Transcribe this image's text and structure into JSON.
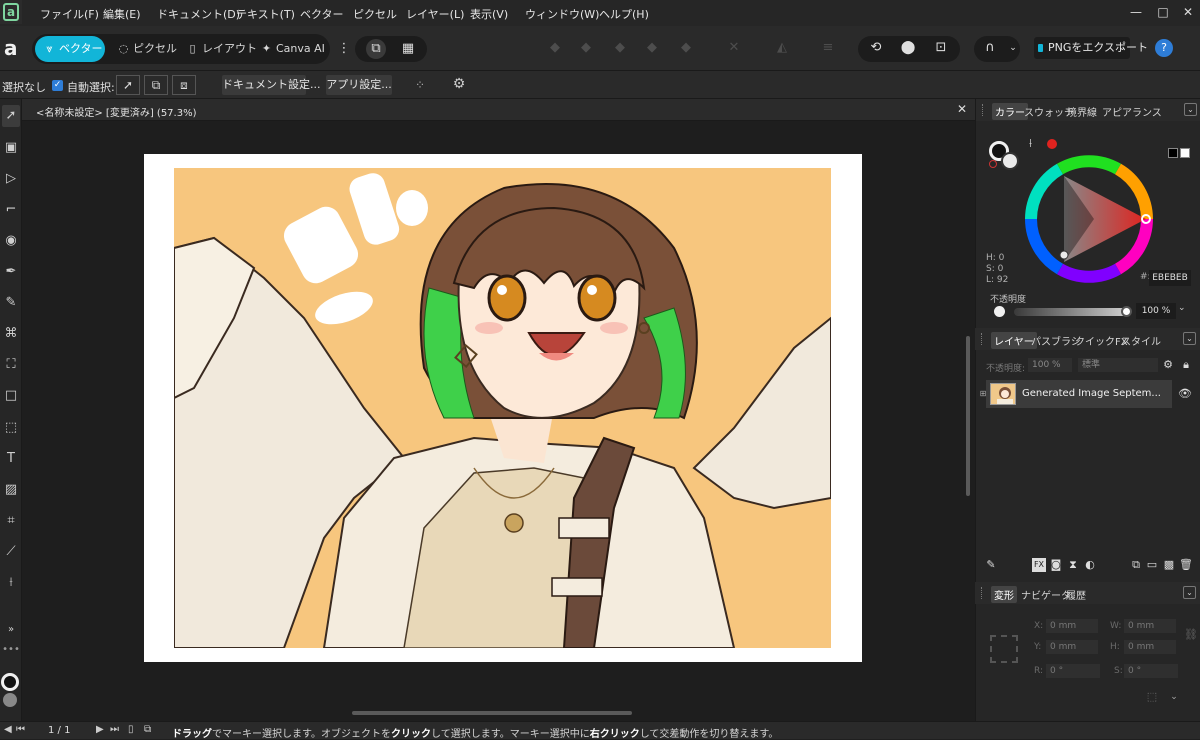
{
  "menubar": {
    "items": [
      "ファイル(F)",
      "編集(E)",
      "ドキュメント(D)",
      "テキスト(T)",
      "ベクター",
      "ピクセル",
      "レイヤー(L)",
      "表示(V)",
      "ウィンドウ(W)",
      "ヘルプ(H)"
    ],
    "window_controls": [
      "—",
      "□",
      "✕"
    ]
  },
  "toolbar": {
    "personas": [
      "ベクター",
      "ピクセル",
      "レイアウト",
      "Canva AI"
    ],
    "active_persona": "ベクター",
    "export_label": "PNGをエクスポート",
    "help_label": "?"
  },
  "contextbar": {
    "selection_text": "選択なし",
    "auto_select_label": "自動選択:",
    "document_settings": "ドキュメント設定...",
    "app_settings": "アプリ設定..."
  },
  "document": {
    "tab_title": "<名称未設定> [変更済み] (57.3%)"
  },
  "color_panel": {
    "tabs": [
      "カラー",
      "スウォッチ",
      "境界線",
      "アピアランス"
    ],
    "active_tab": "カラー",
    "h_label": "H: 0",
    "s_label": "S: 0",
    "l_label": "L: 92",
    "hex_prefix": "#:",
    "hex_value": "EBEBEB",
    "opacity_label": "不透明度",
    "opacity_value": "100 %",
    "accent_color": "#e0231f",
    "current_color": "#ebebeb"
  },
  "layers_panel": {
    "tabs": [
      "レイヤー",
      "パスブラシ",
      "クイックFX",
      "スタイル"
    ],
    "active_tab": "レイヤー",
    "opacity_label": "不透明度:",
    "opacity_value": "100 %",
    "blend_mode": "標準",
    "layers": [
      {
        "name": "Generated Image Septem...",
        "visible": true
      }
    ]
  },
  "transform_panel": {
    "tabs": [
      "変形",
      "ナビゲータ",
      "履歴"
    ],
    "active_tab": "変形",
    "x_label": "X:",
    "x_value": "0 mm",
    "y_label": "Y:",
    "y_value": "0 mm",
    "w_label": "W:",
    "w_value": "0 mm",
    "h_label": "H:",
    "h_value": "0 mm",
    "r_label": "R:",
    "r_value": "0 °",
    "s_label": "S:",
    "s_value": "0 °"
  },
  "statusbar": {
    "page": "1 / 1",
    "hint_1": "ドラッグ",
    "hint_2": "でマーキー選択します。オブジェクトを",
    "hint_3": "クリック",
    "hint_4": "して選択します。マーキー選択中に",
    "hint_5": "右クリック",
    "hint_6": "して交差動作を切り替えます。"
  }
}
